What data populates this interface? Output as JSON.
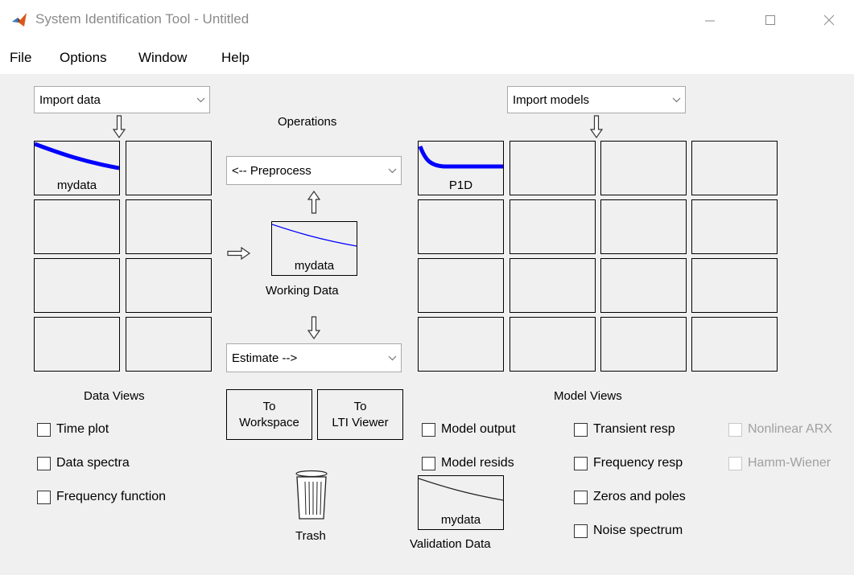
{
  "window": {
    "title": "System Identification Tool - Untitled",
    "controls": [
      "minimize-icon",
      "maximize-icon",
      "close-icon"
    ]
  },
  "menu": [
    "File",
    "Options",
    "Window",
    "Help"
  ],
  "import_data": {
    "selected": "Import data"
  },
  "import_models": {
    "selected": "Import models"
  },
  "operations": {
    "title": "Operations",
    "preprocess": "<-- Preprocess",
    "estimate": "Estimate -->",
    "working_data": {
      "name": "mydata",
      "caption": "Working Data"
    }
  },
  "data_board": {
    "items": [
      {
        "name": "mydata"
      }
    ],
    "caption": "Data Views"
  },
  "model_board": {
    "items": [
      {
        "name": "P1D"
      }
    ],
    "caption": "Model Views"
  },
  "data_views": [
    "Time plot",
    "Data spectra",
    "Frequency function"
  ],
  "buttons": {
    "to_workspace": [
      "To",
      "Workspace"
    ],
    "to_lti_viewer": [
      "To",
      "LTI Viewer"
    ]
  },
  "trash": {
    "label": "Trash"
  },
  "model_checks": {
    "col1": [
      "Model output",
      "Model resids"
    ],
    "col2": [
      "Transient resp",
      "Frequency resp",
      "Zeros and poles",
      "Noise spectrum"
    ],
    "col3": [
      "Nonlinear ARX",
      "Hamm-Wiener"
    ]
  },
  "validation_data": {
    "name": "mydata",
    "caption": "Validation Data"
  },
  "colors": {
    "curve": "#0000ff",
    "disabled_text": "#a0a0a0",
    "background": "#f0f0f0"
  }
}
